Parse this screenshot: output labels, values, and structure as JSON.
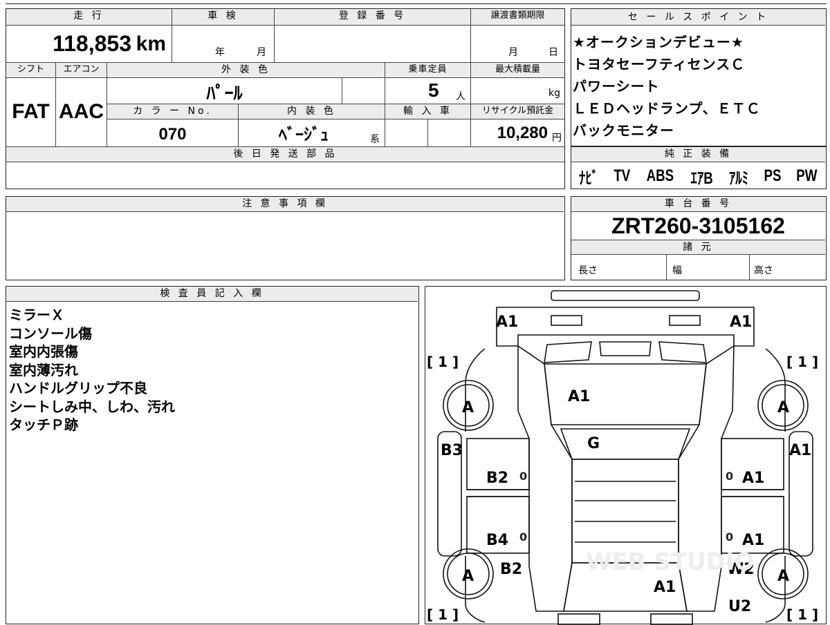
{
  "vehicle": {
    "mileage_label": "走 行",
    "mileage_value": "118,853",
    "mileage_unit": "km",
    "inspection_label": "車 検",
    "inspection_year": "年",
    "inspection_month": "月",
    "reg_label": "登 録 番 号",
    "transfer_label": "譲渡書類期限",
    "transfer_month": "月",
    "transfer_day": "日",
    "shift_label": "シフト",
    "shift_value": "FAT",
    "ac_label": "エアコン",
    "ac_value": "AAC",
    "exterior_label": "外 装 色",
    "exterior_value": "ﾊﾟｰﾙ",
    "capacity_label": "乗車定員",
    "capacity_value": "5",
    "capacity_unit": "人",
    "load_label": "最大積載量",
    "load_unit": "kg",
    "color_no_label": "カ ラ ー No.",
    "color_no_value": "070",
    "interior_label": "内 装 色",
    "interior_value": "ﾍﾞｰｼﾞｭ",
    "interior_suffix": "系",
    "import_label": "輸 入 車",
    "recycle_label": "リサイクル預託金",
    "recycle_value": "10,280",
    "recycle_unit": "円",
    "later_parts_label": "後 日 発 送 部 品"
  },
  "sales_points": {
    "label": "セ ー ル ス ポ イ ン ト",
    "items": [
      "★オークションデビュー★",
      "トヨタセーフティセンスＣ",
      "パワーシート",
      "ＬＥＤヘッドランプ、ＥＴＣ",
      "バックモニター"
    ]
  },
  "equipment": {
    "label": "純 正 装 備",
    "items": [
      "ﾅﾋﾞ",
      "TV",
      "ABS",
      "ｴｱB",
      "ｱﾙﾐ",
      "PS",
      "PW"
    ]
  },
  "notes": {
    "label": "注 意 事 項 欄"
  },
  "chassis": {
    "label": "車 台 番 号",
    "value": "ZRT260-3105162",
    "spec_label": "諸 元",
    "length": "長さ",
    "width": "幅",
    "height": "高さ"
  },
  "inspector": {
    "label": "検 査 員 記 入 欄",
    "lines": [
      "ミラーＸ",
      "コンソール傷",
      "室内内張傷",
      "室内薄汚れ",
      "ハンドルグリップ不良",
      "シートしみ中、しわ、汚れ",
      "タッチＰ跡"
    ]
  },
  "diagram": {
    "marks": {
      "front_left": "A1",
      "front_right": "A1",
      "hood": "A1",
      "windshield": "G",
      "left_front_fender": "B3",
      "right_front_fender": "A1",
      "left_front_door": "B2",
      "right_front_door": "A1",
      "left_rear_door": "B4",
      "right_rear_door": "A1",
      "left_rear_fender": "B2",
      "right_rear_fender": "W2",
      "trunk": "A1",
      "right_rear_panel": "U2",
      "tire_fl": "A",
      "tire_fr": "A",
      "tire_rl": "A",
      "tire_rr": "A",
      "tire_fl_bracket": "[ 1 ]",
      "tire_fr_bracket": "[ 1 ]",
      "tire_rl_bracket": "[ 1 ]",
      "tire_rr_bracket": "[ 1 ]",
      "zero": "0",
      "watermark": "WEB STUDIO"
    }
  }
}
